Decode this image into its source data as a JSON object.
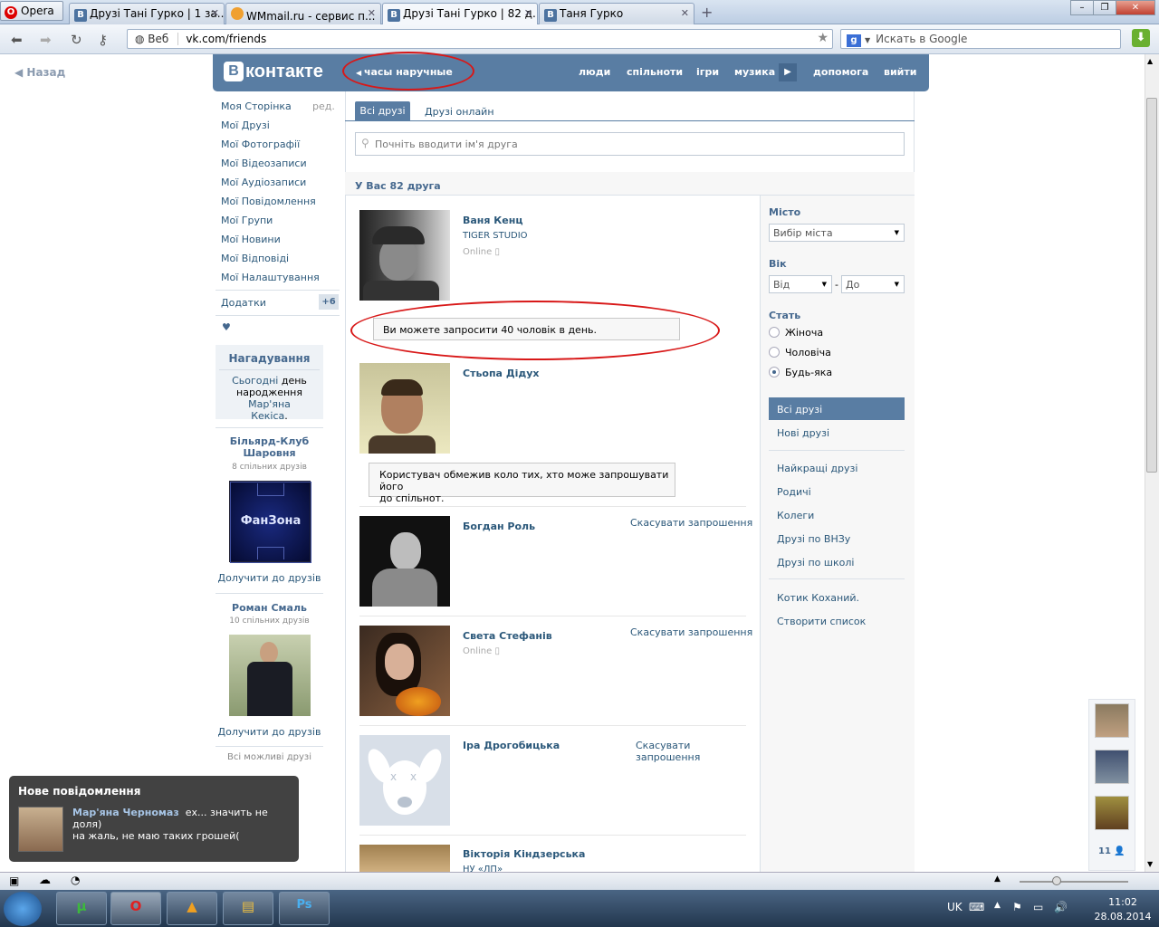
{
  "browser": {
    "menu_label": "Opera",
    "tabs": [
      {
        "title": "Друзі Тані Гурко | 1 за...",
        "icon": "vk-icon"
      },
      {
        "title": "WMmail.ru - сервис п...",
        "icon": "wmmail-icon"
      },
      {
        "title": "Друзі Тані Гурко | 82 д...",
        "icon": "vk-icon"
      },
      {
        "title": "Таня Гурко",
        "icon": "vk-icon"
      }
    ],
    "web_label": "Веб",
    "url": "vk.com/friends",
    "search_placeholder": "Искать в Google"
  },
  "page": {
    "back_label": "Назад",
    "logo_text": "контакте",
    "logo_letter": "В",
    "status": "часы наручные",
    "nav": [
      "люди",
      "спільноти",
      "ігри",
      "музика",
      "допомога",
      "вийти"
    ]
  },
  "left_menu": {
    "items": [
      "Моя Сторінка",
      "Мої Друзі",
      "Мої Фотографії",
      "Мої Відеозаписи",
      "Мої Аудіозаписи",
      "Мої Повідомлення",
      "Мої Групи",
      "Мої Новини",
      "Мої Відповіді",
      "Мої Налаштування"
    ],
    "edit_label": "ред.",
    "apps_label": "Додатки",
    "apps_count": "+6",
    "heart": "♥",
    "reminder_title": "Нагадування",
    "reminder_link1": "Сьогодні",
    "reminder_text1": "день",
    "reminder_text2": "народження",
    "reminder_link2": "Мар'яна",
    "reminder_link3": "Кекіса",
    "reminder_end": ".",
    "suggestions": [
      {
        "name": "Більярд-Клуб Шаровня",
        "sub": "8 спільних друзів",
        "action": "Долучити до друзів",
        "image_text": "ФанЗона"
      },
      {
        "name": "Роман Смаль",
        "sub": "10 спільних друзів",
        "action": "Долучити до друзів"
      }
    ],
    "all_possible": "Всі можливі друзі"
  },
  "main": {
    "tab_all": "Всі друзі",
    "tab_online": "Друзі онлайн",
    "search_placeholder": "Почніть вводити ім'я друга",
    "count_text": "У Вас 82 друга",
    "friends": [
      {
        "name": "Ваня Кенц",
        "sub": "TIGER STUDIO",
        "status": "Online"
      },
      {
        "name": "Стьопа Дідух"
      },
      {
        "name": "Богдан Роль",
        "action": "Скасувати запрошення"
      },
      {
        "name": "Света Стефанів",
        "status": "Online",
        "action": "Скасувати запрошення"
      },
      {
        "name": "Іра Дрогобицька",
        "action_line1": "Скасувати",
        "action_line2": "запрошення"
      },
      {
        "name": "Вікторія Кіндзерська",
        "sub": "НУ «ЛП»"
      }
    ],
    "notice1": "Ви можете запросити 40 чоловік в день.",
    "notice2_line1": "Користувач обмежив коло тих, хто може запрошувати його",
    "notice2_line2": "до спільнот."
  },
  "filter": {
    "city_label": "Місто",
    "city_value": "Вибір міста",
    "age_label": "Вік",
    "age_from": "Від",
    "age_dash": "-",
    "age_to": "До",
    "gender_label": "Стать",
    "gender_options": [
      "Жіноча",
      "Чоловіча",
      "Будь-яка"
    ],
    "gender_selected": "Будь-яка",
    "lists_primary": [
      "Всі друзі",
      "Нові друзі"
    ],
    "lists_secondary": [
      "Найкращі друзі",
      "Родичі",
      "Колеги",
      "Друзі по ВНЗу",
      "Друзі по школі"
    ],
    "lists_custom": [
      "Котик Коханий.",
      "Створити список"
    ]
  },
  "notification": {
    "title": "Нове повідомлення",
    "sender": "Мар'яна Черномаз",
    "text1": "ех... значить не доля)",
    "text2": "на жаль, не маю таких грошей("
  },
  "side": {
    "online_count": "11"
  },
  "taskbar": {
    "lang": "UK",
    "time": "11:02",
    "date": "28.08.2014"
  },
  "colors": {
    "vk_blue": "#597da3",
    "link": "#2b587a",
    "annotation_red": "#d81818"
  }
}
